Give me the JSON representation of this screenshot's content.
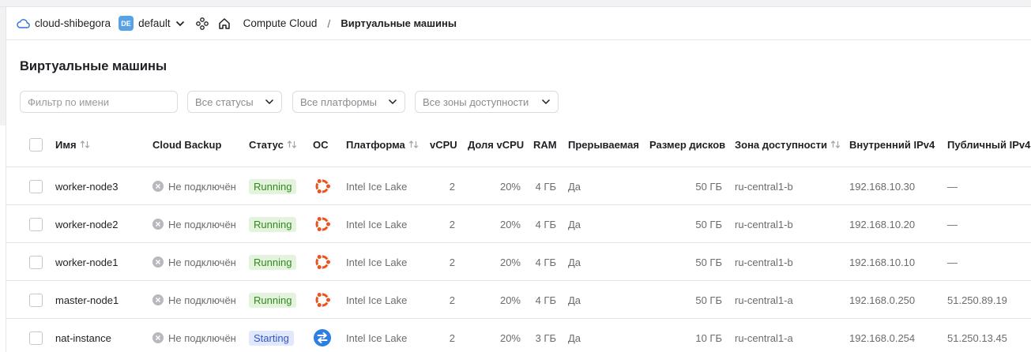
{
  "header": {
    "cloud_name": "cloud-shibegora",
    "folder_badge": "DE",
    "folder_name": "default",
    "breadcrumb_service": "Compute Cloud",
    "breadcrumb_separator": "/",
    "breadcrumb_current": "Виртуальные машины"
  },
  "page": {
    "title": "Виртуальные машины"
  },
  "filters": {
    "name_placeholder": "Фильтр по имени",
    "status_select": "Все статусы",
    "platform_select": "Все платформы",
    "zone_select": "Все зоны доступности"
  },
  "table": {
    "columns": {
      "name": "Имя",
      "backup": "Cloud Backup",
      "status": "Статус",
      "os": "ОС",
      "platform": "Платформа",
      "vcpu": "vCPU",
      "vcpu_share": "Доля vCPU",
      "ram": "RAM",
      "preemptible": "Прерываемая",
      "disk_size": "Размер дисков",
      "zone": "Зона доступности",
      "internal_ip": "Внутренний IPv4",
      "public_ip": "Публичный IPv4"
    },
    "rows": [
      {
        "name": "worker-node3",
        "backup": "Не подключён",
        "status": "Running",
        "os": "ubuntu",
        "platform": "Intel Ice Lake",
        "vcpu": "2",
        "vcpu_share": "20%",
        "ram": "4 ГБ",
        "preemptible": "Да",
        "disk_size": "50 ГБ",
        "zone": "ru-central1-b",
        "internal_ip": "192.168.10.30",
        "public_ip": "—"
      },
      {
        "name": "worker-node2",
        "backup": "Не подключён",
        "status": "Running",
        "os": "ubuntu",
        "platform": "Intel Ice Lake",
        "vcpu": "2",
        "vcpu_share": "20%",
        "ram": "4 ГБ",
        "preemptible": "Да",
        "disk_size": "50 ГБ",
        "zone": "ru-central1-b",
        "internal_ip": "192.168.10.20",
        "public_ip": "—"
      },
      {
        "name": "worker-node1",
        "backup": "Не подключён",
        "status": "Running",
        "os": "ubuntu",
        "platform": "Intel Ice Lake",
        "vcpu": "2",
        "vcpu_share": "20%",
        "ram": "4 ГБ",
        "preemptible": "Да",
        "disk_size": "50 ГБ",
        "zone": "ru-central1-b",
        "internal_ip": "192.168.10.10",
        "public_ip": "—"
      },
      {
        "name": "master-node1",
        "backup": "Не подключён",
        "status": "Running",
        "os": "ubuntu",
        "platform": "Intel Ice Lake",
        "vcpu": "2",
        "vcpu_share": "20%",
        "ram": "4 ГБ",
        "preemptible": "Да",
        "disk_size": "50 ГБ",
        "zone": "ru-central1-a",
        "internal_ip": "192.168.0.250",
        "public_ip": "51.250.89.19"
      },
      {
        "name": "nat-instance",
        "backup": "Не подключён",
        "status": "Starting",
        "os": "nat",
        "platform": "Intel Ice Lake",
        "vcpu": "2",
        "vcpu_share": "20%",
        "ram": "3 ГБ",
        "preemptible": "Да",
        "disk_size": "10 ГБ",
        "zone": "ru-central1-a",
        "internal_ip": "192.168.0.254",
        "public_ip": "51.250.13.45"
      }
    ]
  },
  "colors": {
    "running_bg": "#e4f4dc",
    "running_text": "#2f8a1e",
    "starting_bg": "#e1e8fb",
    "starting_text": "#3056c8",
    "ubuntu": "#e95420",
    "nat": "#2b7fe0",
    "folder_badge": "#57a2e6"
  }
}
